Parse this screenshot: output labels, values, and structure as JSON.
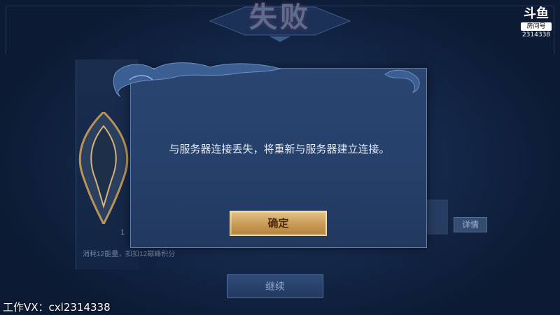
{
  "result_banner": {
    "title": "失败"
  },
  "stream_brand": {
    "logo_text": "斗鱼",
    "room_label": "房间号",
    "room_id": "2314338"
  },
  "dialog": {
    "message": "与服务器连接丢失，将重新与服务器建立连接。",
    "confirm_label": "确定"
  },
  "background": {
    "cost_text": "消耗12能量，扣扣12巅峰积分",
    "level_number": "1",
    "details_label": "详情",
    "continue_label": "继续"
  },
  "watermark": {
    "text": "工作VX：cxl2314338"
  },
  "colors": {
    "accent_gold": "#c89a55",
    "panel_blue": "#25406a"
  }
}
